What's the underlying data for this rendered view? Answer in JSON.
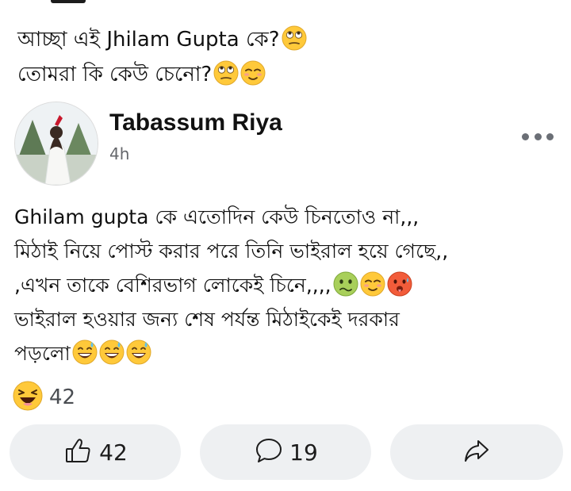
{
  "caption": {
    "line1": "আচ্ছা এই Jhilam Gupta কে?",
    "line2": "তোমরা কি কেউ চেনো?"
  },
  "post": {
    "author": "Tabassum Riya",
    "time": "4h",
    "lines": [
      "Ghilam gupta কে এতোদিন কেউ চিনতোও না,,,",
      "মিঠাই নিয়ে পোস্ট করার পরে তিনি ভাইরাল হয়ে গেছে,,",
      ",এখন তাকে বেশিরভাগ লোকেই চিনে,,,,",
      "ভাইরাল হওয়ার জন্য শেষ পর্যন্ত মিঠাইকেই দরকার",
      "পড়লো"
    ]
  },
  "reactions": {
    "icon": "laughing-emoji-icon",
    "count": "42"
  },
  "actions": {
    "like": {
      "icon": "thumbs-up-icon",
      "count": "42"
    },
    "comment": {
      "icon": "comment-bubble-icon",
      "count": "19"
    },
    "share": {
      "icon": "share-arrow-icon"
    }
  },
  "colors": {
    "emoji_yellow": "#FFC93A",
    "button_bg": "#EEF0F2",
    "secondary_text": "#65676B"
  }
}
